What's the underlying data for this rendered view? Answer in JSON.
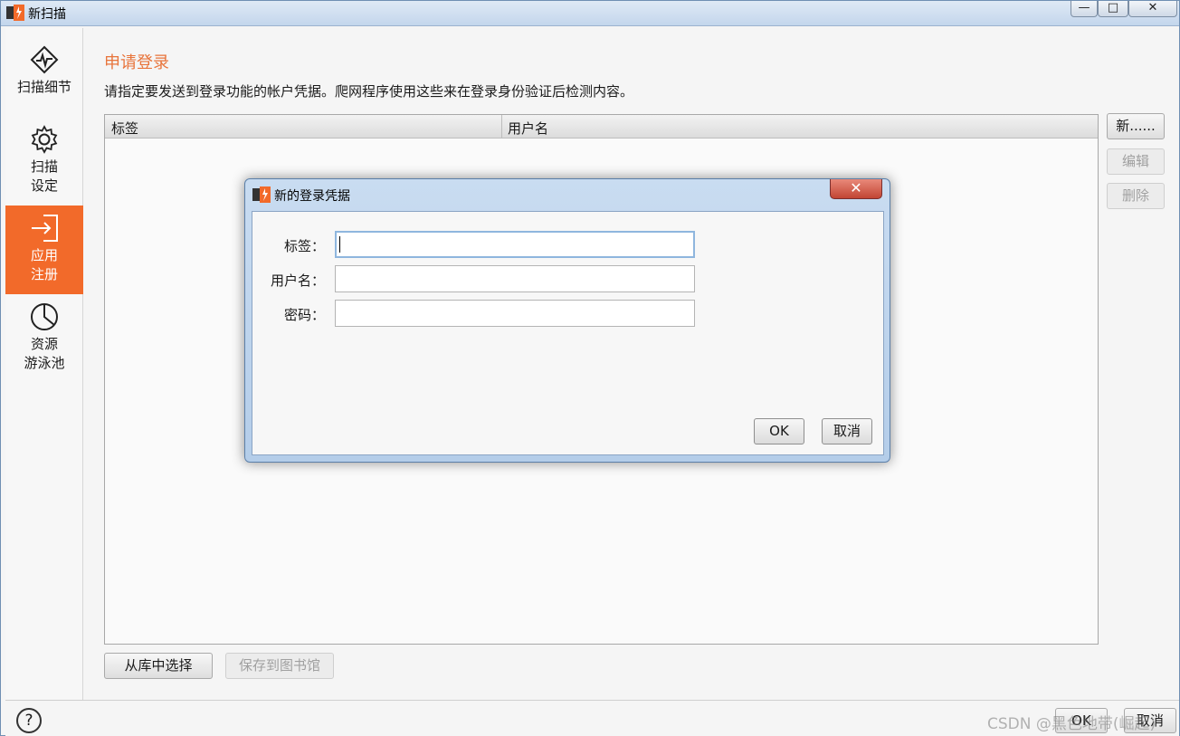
{
  "window": {
    "title": "新扫描",
    "min_glyph": "—",
    "max_glyph": "□",
    "close_glyph": "✕"
  },
  "sidebar": {
    "items": [
      {
        "line1": "扫描细节",
        "line2": "",
        "icon": "scan-details-icon",
        "active": false
      },
      {
        "line1": "扫描",
        "line2": "设定",
        "icon": "gear-icon",
        "active": false
      },
      {
        "line1": "应用",
        "line2": "注册",
        "icon": "login-arrow-icon",
        "active": true
      },
      {
        "line1": "资源",
        "line2": "游泳池",
        "icon": "pie-chart-icon",
        "active": false
      }
    ]
  },
  "main": {
    "heading": "申请登录",
    "description": "请指定要发送到登录功能的帐户凭据。爬网程序使用这些来在登录身份验证后检测内容。",
    "table": {
      "columns": [
        "标签",
        "用户名"
      ],
      "rows": []
    },
    "side_buttons": {
      "new": "新......",
      "edit": "编辑",
      "delete": "删除"
    },
    "bottom_buttons": {
      "from_library": "从库中选择",
      "save_to_library": "保存到图书馆"
    }
  },
  "footer": {
    "help": "?",
    "ok": "OK",
    "cancel": "取消",
    "watermark": "CSDN @黑色地带(崛起)"
  },
  "dialog": {
    "title": "新的登录凭据",
    "close_glyph": "✕",
    "fields": [
      {
        "label": "标签：",
        "value": ""
      },
      {
        "label": "用户名：",
        "value": ""
      },
      {
        "label": "密码：",
        "value": ""
      }
    ],
    "ok": "OK",
    "cancel": "取消"
  },
  "colors": {
    "accent": "#f26a2a",
    "heading": "#e8743b"
  }
}
